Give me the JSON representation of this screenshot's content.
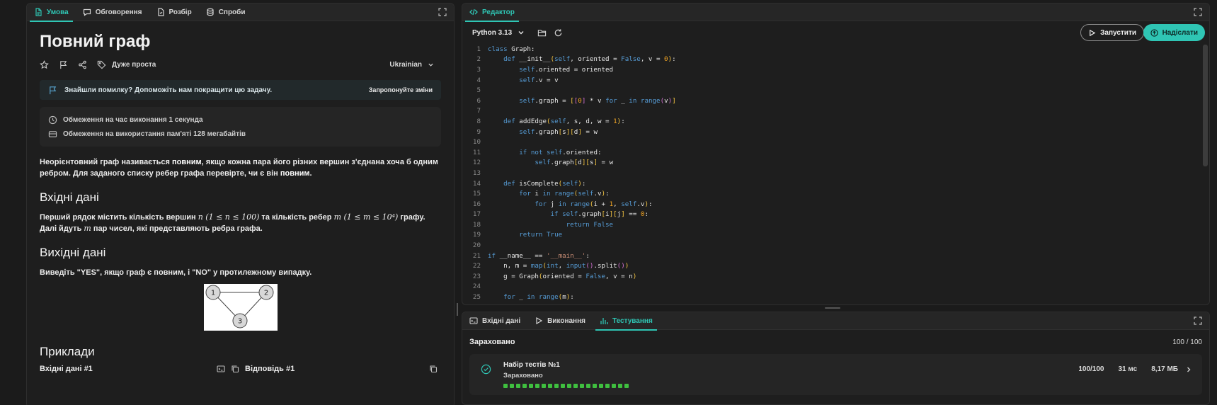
{
  "left_tabs": [
    {
      "label": "Умова",
      "icon": "document-icon",
      "active": true
    },
    {
      "label": "Обговорення",
      "icon": "chat-bubble-icon",
      "active": false
    },
    {
      "label": "Розбір",
      "icon": "file-icon",
      "active": false
    },
    {
      "label": "Спроби",
      "icon": "database-icon",
      "active": false
    }
  ],
  "problem": {
    "title": "Повний граф",
    "difficulty": "Дуже проста",
    "language": "Ukrainian",
    "notice_text": "Знайшли помилку? Допоможіть нам покращити цю задачу.",
    "notice_action": "Запропонуйте зміни",
    "time_limit": "Обмеження на час виконання 1 секунда",
    "memory_limit": "Обмеження на використання пам'яті 128 мегабайтів",
    "statement_part1": "Неорієнтовний граф називається ",
    "statement_bold1": "повним",
    "statement_part2": ", якщо кожна пара його різних вершин з'єднана хоча б одним ребром. Для заданого списку ребер графа перевірте, чи є він ",
    "statement_bold2": "повним",
    "statement_part3": ".",
    "input_heading": "Вхідні дані",
    "input_text_1": "Перший рядок містить кількість вершин ",
    "input_math_n": "n (1 ≤ n ≤ 100)",
    "input_text_2": " та кількість ребер ",
    "input_math_m": "m (1 ≤ m ≤ 10⁴)",
    "input_text_3": " графу. Далі йдуть ",
    "input_math_m2": "m",
    "input_text_4": " пар чисел, які представляють ребра графа.",
    "output_heading": "Вихідні дані",
    "output_text": "Виведіть \"YES\", якщо граф є повним, і \"NO\" у протилежному випадку.",
    "graph_nodes": [
      "1",
      "2",
      "3"
    ],
    "examples_heading": "Приклади",
    "example_input_label": "Вхідні дані #1",
    "example_output_label": "Відповідь #1"
  },
  "editor": {
    "tab_label": "Редактор",
    "python_version": "Python 3.13",
    "run_label": "Запустити",
    "submit_label": "Надіслати",
    "accent_color": "#2fc5b4"
  },
  "code_lines": [
    "class Graph:",
    "    def __init__(self, oriented = False, v = 0):",
    "        self.oriented = oriented",
    "        self.v = v",
    "",
    "        self.graph = [[0] * v for _ in range(v)]",
    "",
    "    def addEdge(self, s, d, w = 1):",
    "        self.graph[s][d] = w",
    "",
    "        if not self.oriented:",
    "            self.graph[d][s] = w",
    "",
    "    def isComplete(self):",
    "        for i in range(self.v):",
    "            for j in range(i + 1, self.v):",
    "                if self.graph[i][j] == 0:",
    "                    return False",
    "        return True",
    "",
    "if __name__ == '__main__':",
    "    n, m = map(int, input().split())",
    "    g = Graph(oriented = False, v = n)",
    "",
    "    for _ in range(m):"
  ],
  "bottom_tabs": [
    {
      "label": "Вхідні дані",
      "icon": "terminal-icon",
      "active": false
    },
    {
      "label": "Виконання",
      "icon": "play-icon",
      "active": false
    },
    {
      "label": "Тестування",
      "icon": "bar-chart-icon",
      "active": true
    }
  ],
  "result": {
    "status": "Зараховано",
    "score": "100 / 100",
    "testset_title": "Набір тестів №1",
    "testset_status": "Зараховано",
    "testset_score": "100/100",
    "testset_time": "31 мс",
    "testset_memory": "8,17 МБ",
    "passed_tests": 20,
    "passed_color": "#3fbf3f"
  }
}
